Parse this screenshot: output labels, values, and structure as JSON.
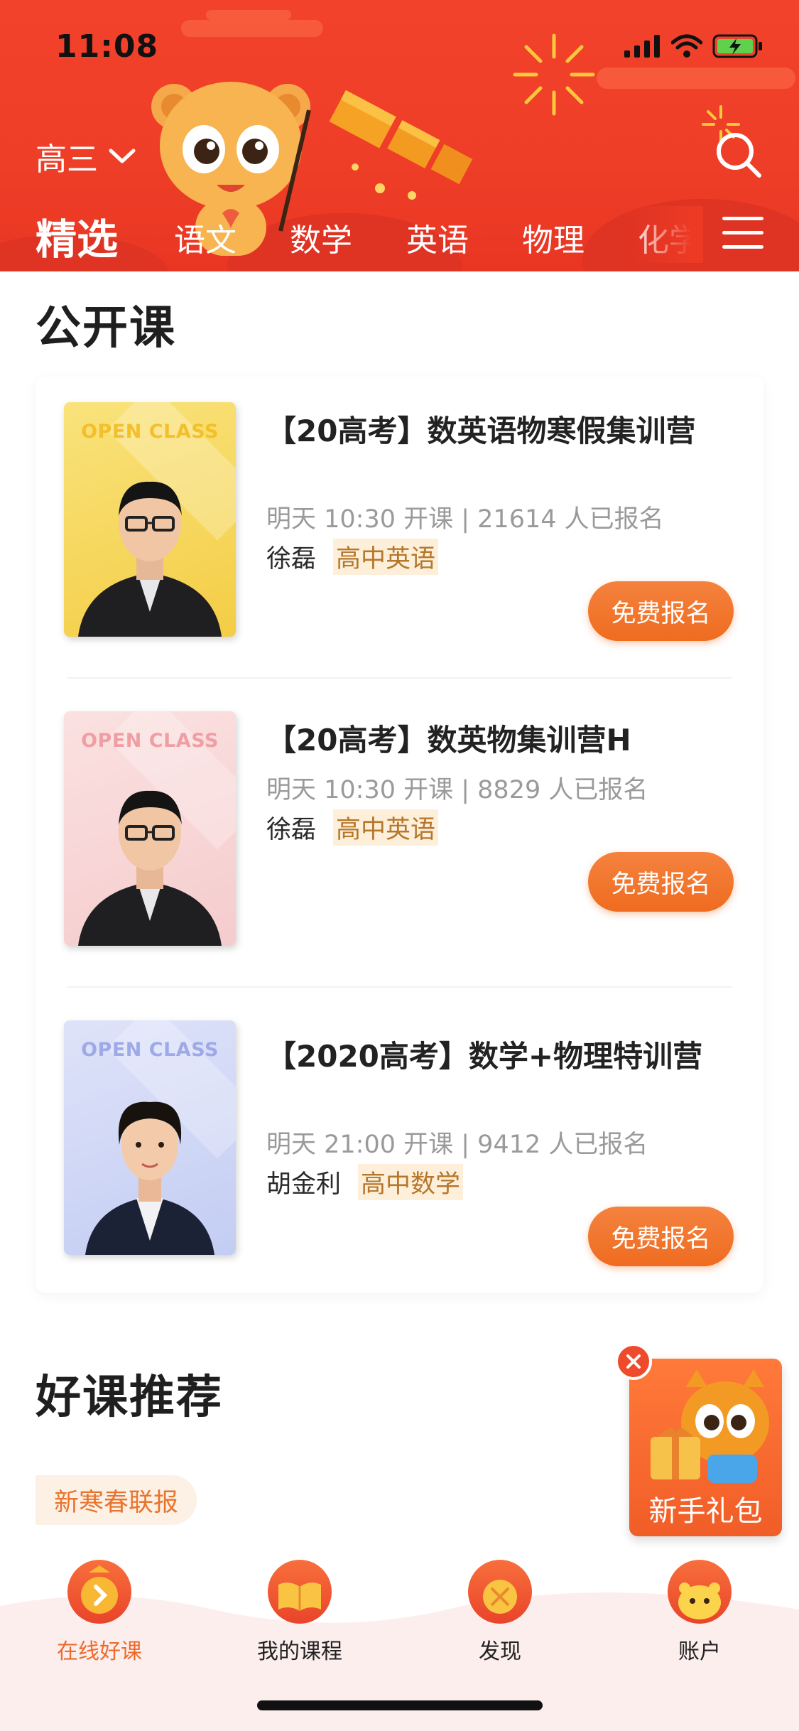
{
  "status_bar": {
    "time": "11:08"
  },
  "header": {
    "grade_label": "高三",
    "tabs": [
      {
        "label": "精选",
        "active": true
      },
      {
        "label": "语文",
        "active": false
      },
      {
        "label": "数学",
        "active": false
      },
      {
        "label": "英语",
        "active": false
      },
      {
        "label": "物理",
        "active": false
      },
      {
        "label": "化学",
        "active": false
      }
    ],
    "icons": {
      "search": "search-icon",
      "menu": "menu-icon",
      "dropdown": "chevron-down-icon"
    }
  },
  "open_class": {
    "title": "公开课",
    "badge_text": "OPEN CLASS",
    "courses": [
      {
        "title": "【20高考】数英语物寒假集训营",
        "meta": "明天 10:30 开课 | 21614 人已报名",
        "teacher": "徐磊",
        "tag": "高中英语",
        "button": "免费报名",
        "theme": "#f6d35b"
      },
      {
        "title": "【20高考】数英物集训营H",
        "meta": "明天 10:30 开课 | 8829 人已报名",
        "teacher": "徐磊",
        "tag": "高中英语",
        "button": "免费报名",
        "theme": "#f7d3d3"
      },
      {
        "title": "【2020高考】数学+物理特训营",
        "meta": "明天 21:00 开课 | 9412 人已报名",
        "teacher": "胡金利",
        "tag": "高中数学",
        "button": "免费报名",
        "theme": "#c9d2f4"
      }
    ]
  },
  "recommend": {
    "title": "好课推荐",
    "badge": "新寒春联报"
  },
  "gift": {
    "label": "新手礼包"
  },
  "bottom_nav": [
    {
      "label": "在线好课",
      "icon": "online-course-icon",
      "active": true
    },
    {
      "label": "我的课程",
      "icon": "my-course-book-icon",
      "active": false
    },
    {
      "label": "发现",
      "icon": "discover-icon",
      "active": false
    },
    {
      "label": "账户",
      "icon": "account-mascot-icon",
      "active": false
    }
  ],
  "colors": {
    "header_red": "#ef3e27",
    "accent_orange": "#ef6c20",
    "tag_bg": "#fdefd9"
  }
}
